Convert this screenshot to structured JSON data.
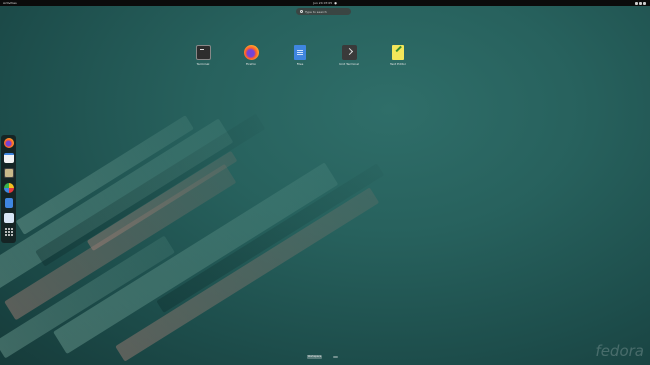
{
  "topbar": {
    "activities_label": "Activities",
    "clock": "Jun 24 07:05",
    "tray_icons": [
      "network-icon",
      "volume-icon",
      "power-icon"
    ]
  },
  "search": {
    "placeholder": "Type to search"
  },
  "apps": [
    {
      "id": "terminal",
      "label": "Terminal",
      "icon": "terminal-icon"
    },
    {
      "id": "firefox",
      "label": "Firefox",
      "icon": "firefox-icon"
    },
    {
      "id": "files",
      "label": "Files",
      "icon": "files-icon"
    },
    {
      "id": "user-terminal",
      "label": "Unit Terminal",
      "icon": "console-icon"
    },
    {
      "id": "text-editor",
      "label": "Text Editor",
      "icon": "text-editor-icon"
    }
  ],
  "dash": [
    "firefox-icon",
    "calendar-icon",
    "disk-icon",
    "software-icon",
    "files-icon",
    "help-icon",
    "show-apps-icon"
  ],
  "workspace": {
    "label": "Workspace"
  },
  "logo": {
    "text": "fedora"
  },
  "colors": {
    "topbar": "#0b0b0b",
    "wallpaper": "#27615d",
    "dash": "#141c1c"
  }
}
